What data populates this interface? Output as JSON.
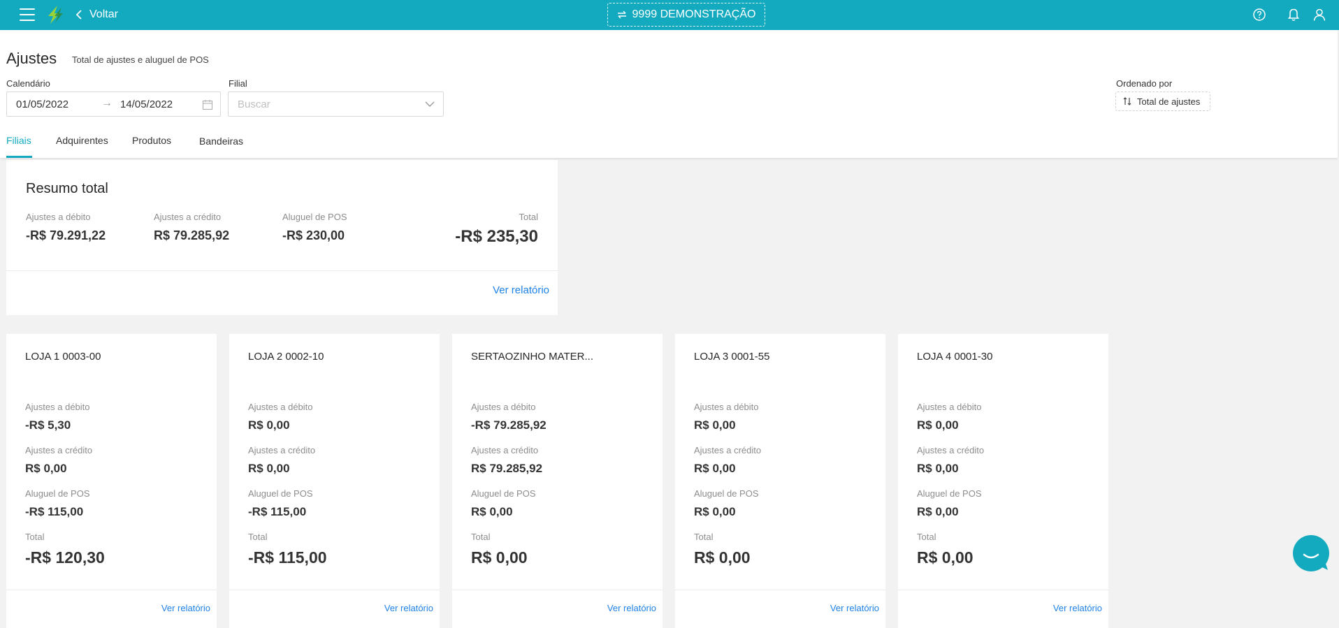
{
  "topbar": {
    "back_label": "Voltar",
    "company_label": "9999 DEMONSTRAÇÃO",
    "color": "#13aac0"
  },
  "header": {
    "title": "Ajustes",
    "subtitle": "Total de ajustes e aluguel de POS",
    "calendar_label": "Calendário",
    "date_start": "01/05/2022",
    "date_end": "14/05/2022",
    "filial_label": "Filial",
    "filial_placeholder": "Buscar",
    "order_label": "Ordenado por",
    "order_value": "Total de ajustes"
  },
  "tabs": [
    {
      "label": "Filiais",
      "active": true
    },
    {
      "label": "Adquirentes",
      "active": false
    },
    {
      "label": "Produtos",
      "active": false
    },
    {
      "label": "Bandeiras",
      "active": false
    }
  ],
  "summary": {
    "title": "Resumo total",
    "debit_label": "Ajustes a débito",
    "debit_value": "-R$ 79.291,22",
    "credit_label": "Ajustes a crédito",
    "credit_value": "R$ 79.285,92",
    "rent_label": "Aluguel de POS",
    "rent_value": "-R$ 230,00",
    "total_label": "Total",
    "total_value": "-R$ 235,30",
    "link": "Ver relatório"
  },
  "stores": [
    {
      "name": "LOJA 1 0003-00",
      "debit_label": "Ajustes a débito",
      "debit": "-R$ 5,30",
      "credit_label": "Ajustes a crédito",
      "credit": "R$ 0,00",
      "rent_label": "Aluguel de POS",
      "rent": "-R$ 115,00",
      "total_label": "Total",
      "total": "-R$ 120,30",
      "link": "Ver relatório"
    },
    {
      "name": "LOJA 2 0002-10",
      "debit_label": "Ajustes a débito",
      "debit": "R$ 0,00",
      "credit_label": "Ajustes a crédito",
      "credit": "R$ 0,00",
      "rent_label": "Aluguel de POS",
      "rent": "-R$ 115,00",
      "total_label": "Total",
      "total": "-R$ 115,00",
      "link": "Ver relatório"
    },
    {
      "name": "SERTAOZINHO MATER...",
      "debit_label": "Ajustes a débito",
      "debit": "-R$ 79.285,92",
      "credit_label": "Ajustes a crédito",
      "credit": "R$ 79.285,92",
      "rent_label": "Aluguel de POS",
      "rent": "R$ 0,00",
      "total_label": "Total",
      "total": "R$ 0,00",
      "link": "Ver relatório"
    },
    {
      "name": "LOJA 3 0001-55",
      "debit_label": "Ajustes a débito",
      "debit": "R$ 0,00",
      "credit_label": "Ajustes a crédito",
      "credit": "R$ 0,00",
      "rent_label": "Aluguel de POS",
      "rent": "R$ 0,00",
      "total_label": "Total",
      "total": "R$ 0,00",
      "link": "Ver relatório"
    },
    {
      "name": "LOJA 4 0001-30",
      "debit_label": "Ajustes a débito",
      "debit": "R$ 0,00",
      "credit_label": "Ajustes a crédito",
      "credit": "R$ 0,00",
      "rent_label": "Aluguel de POS",
      "rent": "R$ 0,00",
      "total_label": "Total",
      "total": "R$ 0,00",
      "link": "Ver relatório"
    }
  ]
}
